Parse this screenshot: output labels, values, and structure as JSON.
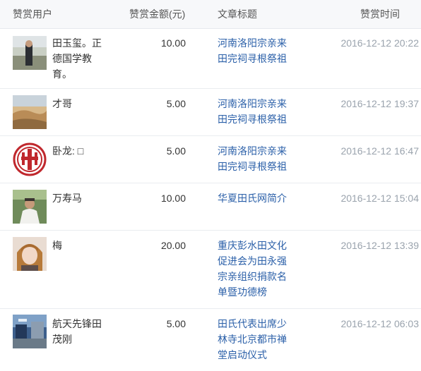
{
  "header": {
    "user": "赞赏用户",
    "amount": "赞赏金额(元)",
    "title": "文章标题",
    "time": "赞赏时间"
  },
  "rows": [
    {
      "name": "田玉玺。正德国学教育。",
      "amount": "10.00",
      "title": "河南洛阳宗亲来田完祠寻根祭祖",
      "time": "2016-12-12 20:22"
    },
    {
      "name": "才哥",
      "amount": "5.00",
      "title": "河南洛阳宗亲来田完祠寻根祭祖",
      "time": "2016-12-12 19:37"
    },
    {
      "name": "卧龙: □",
      "amount": "5.00",
      "title": "河南洛阳宗亲来田完祠寻根祭祖",
      "time": "2016-12-12 16:47"
    },
    {
      "name": "万寿马",
      "amount": "10.00",
      "title": "华夏田氏网简介",
      "time": "2016-12-12 15:04"
    },
    {
      "name": "梅",
      "amount": "20.00",
      "title": "重庆彭水田文化促进会为田永强宗亲组织捐款名单暨功德榜",
      "time": "2016-12-12 13:39"
    },
    {
      "name": "航天先锋田茂刚",
      "amount": "5.00",
      "title": "田氏代表出席少林寺北京都市禅堂启动仪式",
      "time": "2016-12-12 06:03"
    }
  ],
  "colors": {
    "link": "#2a5fa8",
    "time": "#9aa3ad",
    "seal": "#c0282d"
  }
}
